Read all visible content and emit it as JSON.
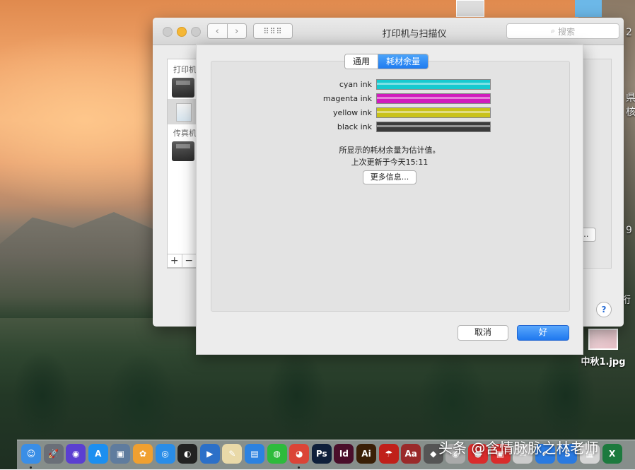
{
  "window": {
    "title": "打印机与扫描仪",
    "search_placeholder": "搜索",
    "grid_glyph": "⠿⠿⠿"
  },
  "sidebar": {
    "section_printers": "打印机",
    "section_fax": "传真机",
    "add_glyph": "+",
    "remove_glyph": "−"
  },
  "right_panel": {
    "options_button_fragment": "…",
    "help_button": "?"
  },
  "sheet": {
    "tabs": [
      {
        "label": "通用",
        "active": false
      },
      {
        "label": "耗材余量",
        "active": true
      }
    ],
    "inks": [
      {
        "label": "cyan ink",
        "color": "#17c9cf",
        "level": 1.0
      },
      {
        "label": "magenta ink",
        "color": "#d11bbd",
        "level": 1.0
      },
      {
        "label": "yellow ink",
        "color": "#c9c21a",
        "level": 1.0
      },
      {
        "label": "black ink",
        "color": "#3b3b3b",
        "level": 1.0
      }
    ],
    "note_estimate": "所显示的耗材余量为估计值。",
    "note_updated": "上次更新于今天15:11",
    "more_info_button": "更多信息...",
    "cancel_button": "取消",
    "ok_button": "好"
  },
  "desktop": {
    "file_name": "中秋1.jpg",
    "right_edge_fragments": [
      "2",
      "県",
      "核",
      "9",
      "桁"
    ]
  },
  "dock": {
    "icons": [
      {
        "name": "finder-icon",
        "glyph": "☺",
        "color": "#3a8ee6"
      },
      {
        "name": "launchpad-icon",
        "glyph": "🚀",
        "color": "#6a6f78"
      },
      {
        "name": "siri-icon",
        "glyph": "◉",
        "color": "#5b3fd1"
      },
      {
        "name": "app-store-icon",
        "glyph": "A",
        "color": "#1c8ff0"
      },
      {
        "name": "preview-icon",
        "glyph": "▣",
        "color": "#5f7c9e"
      },
      {
        "name": "photos-icon",
        "glyph": "✿",
        "color": "#f0a030"
      },
      {
        "name": "safari-icon",
        "glyph": "◎",
        "color": "#2a8de8"
      },
      {
        "name": "qq-icon",
        "glyph": "◐",
        "color": "#222222"
      },
      {
        "name": "quicktime-icon",
        "glyph": "▶",
        "color": "#2c70c8"
      },
      {
        "name": "textedit-icon",
        "glyph": "✎",
        "color": "#e9d9a8"
      },
      {
        "name": "keynote-icon",
        "glyph": "▤",
        "color": "#2c82e0"
      },
      {
        "name": "wechat-icon",
        "glyph": "◍",
        "color": "#2dbb3c"
      },
      {
        "name": "chrome-icon",
        "glyph": "◕",
        "color": "#db4437"
      },
      {
        "name": "photoshop-icon",
        "glyph": "Ps",
        "color": "#0e1f3a"
      },
      {
        "name": "indesign-icon",
        "glyph": "Id",
        "color": "#4a0e2a"
      },
      {
        "name": "illustrator-icon",
        "glyph": "Ai",
        "color": "#3a1f06"
      },
      {
        "name": "acrobat-icon",
        "glyph": "☂",
        "color": "#c0201a"
      },
      {
        "name": "dictionary-icon",
        "glyph": "Aa",
        "color": "#9a2a2a"
      },
      {
        "name": "app-icon-19",
        "glyph": "◆",
        "color": "#555555"
      },
      {
        "name": "app-icon-20",
        "glyph": "◉",
        "color": "#aaaaaa"
      },
      {
        "name": "app-icon-21",
        "glyph": "●",
        "color": "#d92c2c"
      },
      {
        "name": "app-icon-22",
        "glyph": "▣",
        "color": "#d92c2c"
      },
      {
        "name": "app-icon-23",
        "glyph": "✉",
        "color": "#cccccc"
      },
      {
        "name": "app-icon-24",
        "glyph": "✔",
        "color": "#2a7ae0"
      },
      {
        "name": "app-icon-25",
        "glyph": "S",
        "color": "#2a7ae0"
      },
      {
        "name": "app-icon-26",
        "glyph": "▦",
        "color": "#d5d5d5"
      },
      {
        "name": "excel-icon",
        "glyph": "X",
        "color": "#1d7a3e"
      }
    ]
  },
  "watermark": "头条 @含情脉脉之林老师"
}
